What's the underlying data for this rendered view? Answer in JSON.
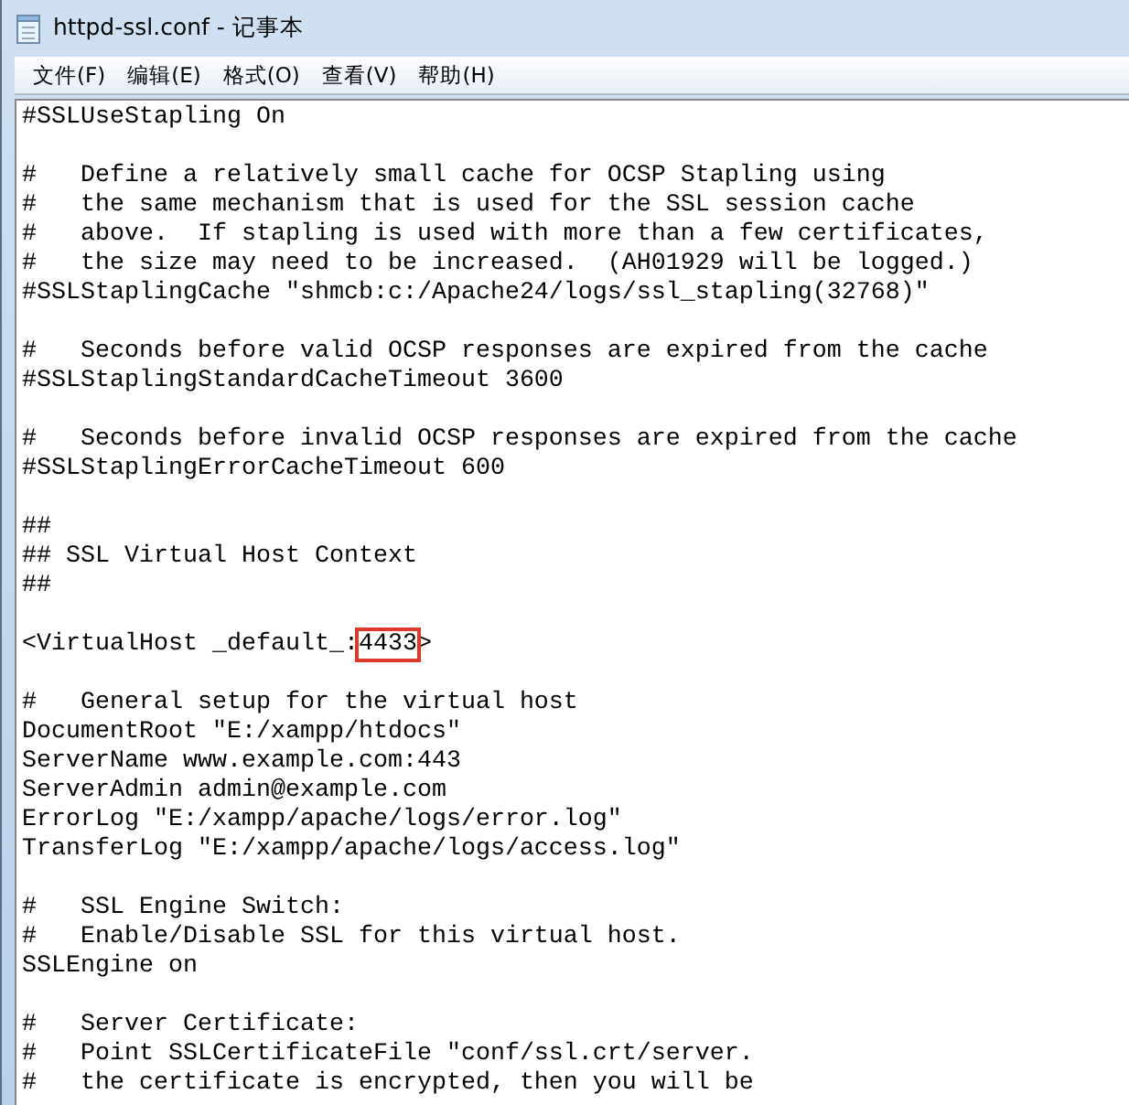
{
  "window": {
    "title": "httpd-ssl.conf - 记事本"
  },
  "menu": [
    "文件(F)",
    "编辑(E)",
    "格式(O)",
    "查看(V)",
    "帮助(H)"
  ],
  "lines": [
    {
      "kind": "text",
      "text": "#SSLUseStapling On"
    },
    {
      "kind": "blank"
    },
    {
      "kind": "text",
      "text": "#   Define a relatively small cache for OCSP Stapling using"
    },
    {
      "kind": "text",
      "text": "#   the same mechanism that is used for the SSL session cache"
    },
    {
      "kind": "text",
      "text": "#   above.  If stapling is used with more than a few certificates,"
    },
    {
      "kind": "text",
      "text": "#   the size may need to be increased.  (AH01929 will be logged.)"
    },
    {
      "kind": "text",
      "text": "#SSLStaplingCache \"shmcb:c:/Apache24/logs/ssl_stapling(32768)\""
    },
    {
      "kind": "blank"
    },
    {
      "kind": "text",
      "text": "#   Seconds before valid OCSP responses are expired from the cache"
    },
    {
      "kind": "text",
      "text": "#SSLStaplingStandardCacheTimeout 3600"
    },
    {
      "kind": "blank"
    },
    {
      "kind": "text",
      "text": "#   Seconds before invalid OCSP responses are expired from the cache"
    },
    {
      "kind": "text",
      "text": "#SSLStaplingErrorCacheTimeout 600"
    },
    {
      "kind": "blank"
    },
    {
      "kind": "text",
      "text": "##"
    },
    {
      "kind": "text",
      "text": "## SSL Virtual Host Context"
    },
    {
      "kind": "text",
      "text": "##"
    },
    {
      "kind": "blank"
    },
    {
      "kind": "marked",
      "before": "<VirtualHost _default_:",
      "mark": "4433",
      "after": ">"
    },
    {
      "kind": "blank"
    },
    {
      "kind": "text",
      "text": "#   General setup for the virtual host"
    },
    {
      "kind": "text",
      "text": "DocumentRoot \"E:/xampp/htdocs\""
    },
    {
      "kind": "text",
      "text": "ServerName www.example.com:443"
    },
    {
      "kind": "text",
      "text": "ServerAdmin admin@example.com"
    },
    {
      "kind": "text",
      "text": "ErrorLog \"E:/xampp/apache/logs/error.log\""
    },
    {
      "kind": "text",
      "text": "TransferLog \"E:/xampp/apache/logs/access.log\""
    },
    {
      "kind": "blank"
    },
    {
      "kind": "text",
      "text": "#   SSL Engine Switch:"
    },
    {
      "kind": "text",
      "text": "#   Enable/Disable SSL for this virtual host."
    },
    {
      "kind": "text",
      "text": "SSLEngine on"
    },
    {
      "kind": "blank"
    },
    {
      "kind": "text",
      "text": "#   Server Certificate:"
    },
    {
      "kind": "text",
      "text": "#   Point SSLCertificateFile \"conf/ssl.crt/server."
    },
    {
      "kind": "text",
      "text": "#   the certificate is encrypted, then you will be"
    }
  ]
}
